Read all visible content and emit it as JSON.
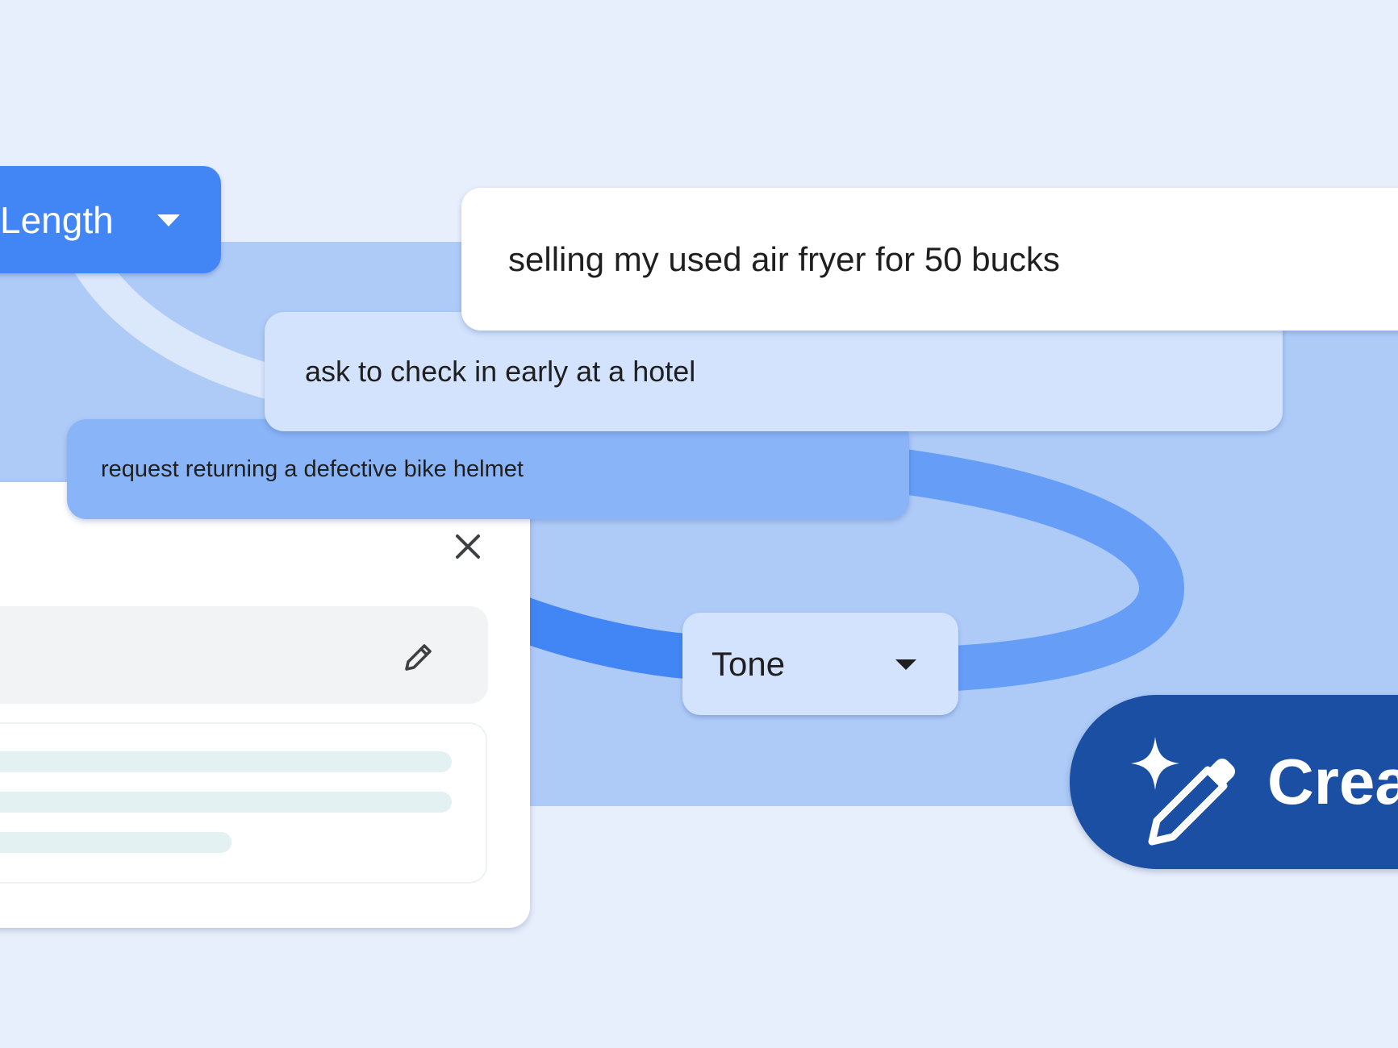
{
  "length_chip": {
    "label": "Length",
    "icon": "dropdown-arrow-icon"
  },
  "prompts": [
    {
      "text": "selling my used air fryer for 50 bucks"
    },
    {
      "text": "ask to check in early at a hotel"
    },
    {
      "text": "request returning a defective bike helmet"
    }
  ],
  "panel": {
    "close_icon": "close-icon",
    "edit_icon": "pencil-icon"
  },
  "tone_chip": {
    "label": "Tone",
    "icon": "dropdown-arrow-icon"
  },
  "create_button": {
    "label": "Create",
    "icon": "sparkle-pencil-icon"
  },
  "colors": {
    "background": "#e8effc",
    "band": "#aecbf8",
    "primary_blue": "#4285f4",
    "light_blue": "#d3e3fd",
    "mid_blue": "#8ab4f8",
    "dark_blue": "#1a4fa3"
  }
}
